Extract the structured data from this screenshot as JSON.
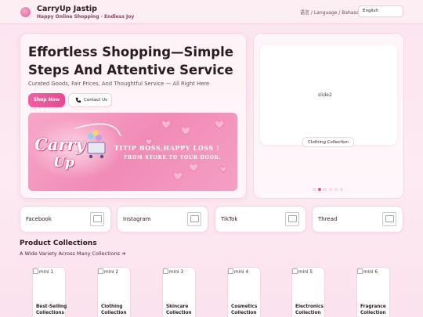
{
  "header": {
    "brand_title": "CarryUp Jastip",
    "brand_subtitle": "Happy Online Shopping · Endless Joy",
    "language_label": "语言 / Language / Bahasa",
    "language_value": "English"
  },
  "hero": {
    "title": "Effortless Shopping—Simple Steps And Attentive Service",
    "subtitle": "Curated Goods, Fair Prices, And Thoughtful Service — All Right Here",
    "shop_button": "Shop Now",
    "contact_button": "Contact Us",
    "banner": {
      "logo_text_1": "Carry",
      "logo_text_2": "Up",
      "tagline": "TITIP BOSS,HAPPY LOSS !",
      "subline": "FROM STORE TO YOUR DOOR."
    }
  },
  "slider": {
    "image_alt": "slide2",
    "caption": "Clothing Collection",
    "active_index": 1,
    "dot_count": 6
  },
  "social": [
    {
      "label": "Facebook"
    },
    {
      "label": "Instagram"
    },
    {
      "label": "TikTok"
    },
    {
      "label": "Thread"
    }
  ],
  "collections": {
    "title": "Product Collections",
    "subtitle": "A Wide Variety Across Many Collections ➔",
    "items": [
      {
        "alt": "mini 1",
        "label": "Best-Selling Collections"
      },
      {
        "alt": "mini 2",
        "label": "Clothing Collection"
      },
      {
        "alt": "mini 3",
        "label": "Skincare Collection"
      },
      {
        "alt": "mini 4",
        "label": "Cosmetics Collection"
      },
      {
        "alt": "mini 5",
        "label": "Electronics Collection"
      },
      {
        "alt": "mini 6",
        "label": "Fragrance Collection"
      }
    ]
  },
  "colors": {
    "accent": "#e9488f",
    "background": "#fbe4ef",
    "banner": "#f18bb6"
  }
}
